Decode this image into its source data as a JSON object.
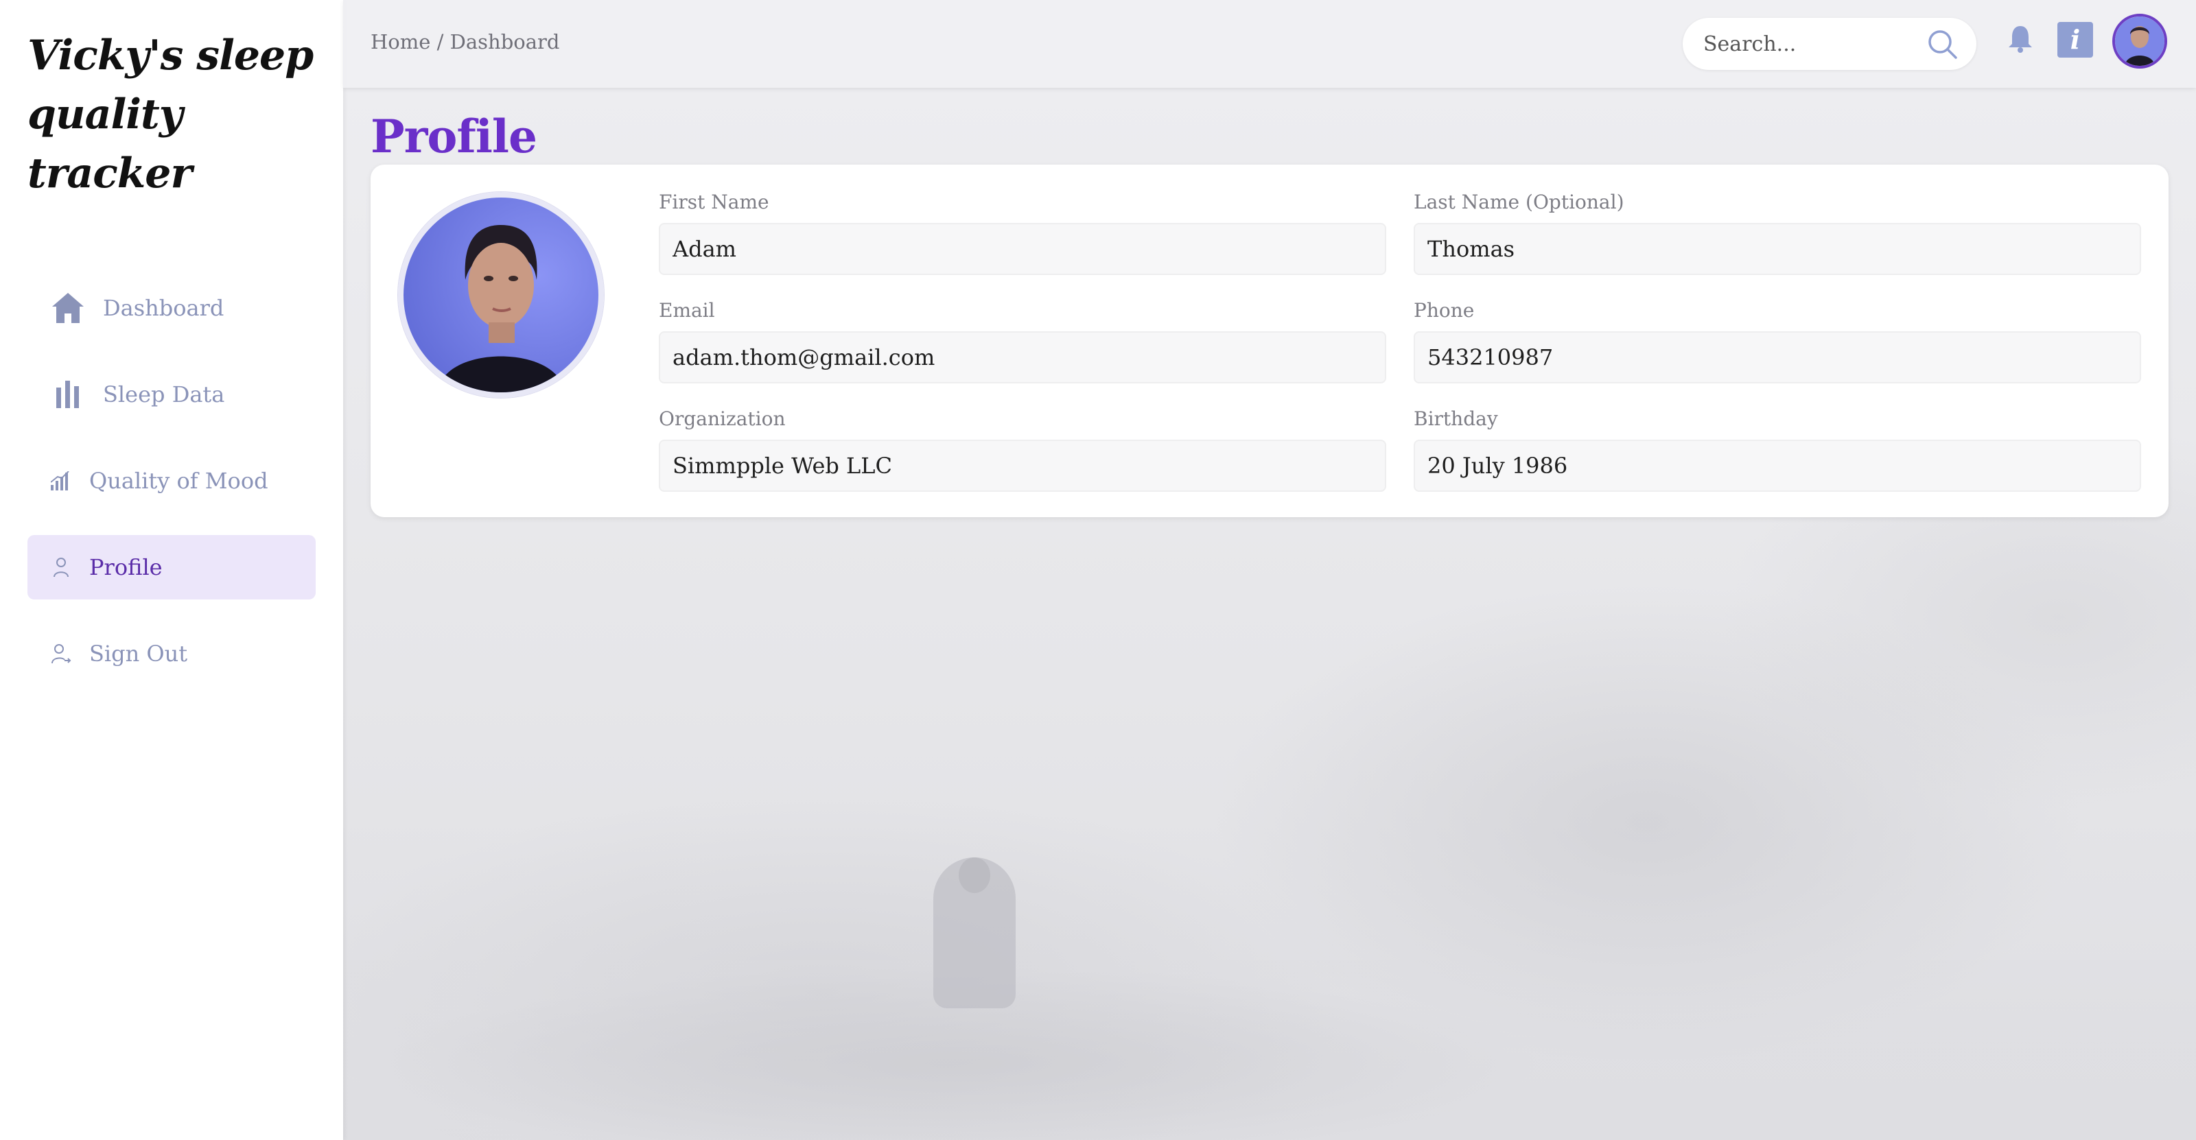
{
  "app": {
    "title": "Vicky's sleep quality tracker"
  },
  "sidebar": {
    "items": [
      {
        "label": "Dashboard",
        "icon": "home-icon",
        "active": false
      },
      {
        "label": "Sleep Data",
        "icon": "bar-chart-icon",
        "active": false
      },
      {
        "label": "Quality of Mood",
        "icon": "signal-chart-icon",
        "active": false
      },
      {
        "label": "Profile",
        "icon": "user-icon",
        "active": true
      },
      {
        "label": "Sign Out",
        "icon": "user-logout-icon",
        "active": false
      }
    ]
  },
  "topbar": {
    "breadcrumb": "Home / Dashboard",
    "search_placeholder": "Search...",
    "icons": [
      "search-icon",
      "bell-icon",
      "info-icon",
      "avatar"
    ]
  },
  "page": {
    "title": "Profile"
  },
  "profile": {
    "first_name": {
      "label": "First Name",
      "value": "Adam"
    },
    "last_name": {
      "label": "Last Name (Optional)",
      "value": "Thomas"
    },
    "email": {
      "label": "Email",
      "value": "adam.thom@gmail.com"
    },
    "phone": {
      "label": "Phone",
      "value": "543210987"
    },
    "organization": {
      "label": "Organization",
      "value": "Simmpple Web LLC"
    },
    "birthday": {
      "label": "Birthday",
      "value": "20 July 1986"
    }
  },
  "colors": {
    "accent": "#6a2fc9",
    "nav_text": "#8a93b8",
    "active_nav_bg": "#ece6fa",
    "active_nav_text": "#5a2ca8"
  }
}
